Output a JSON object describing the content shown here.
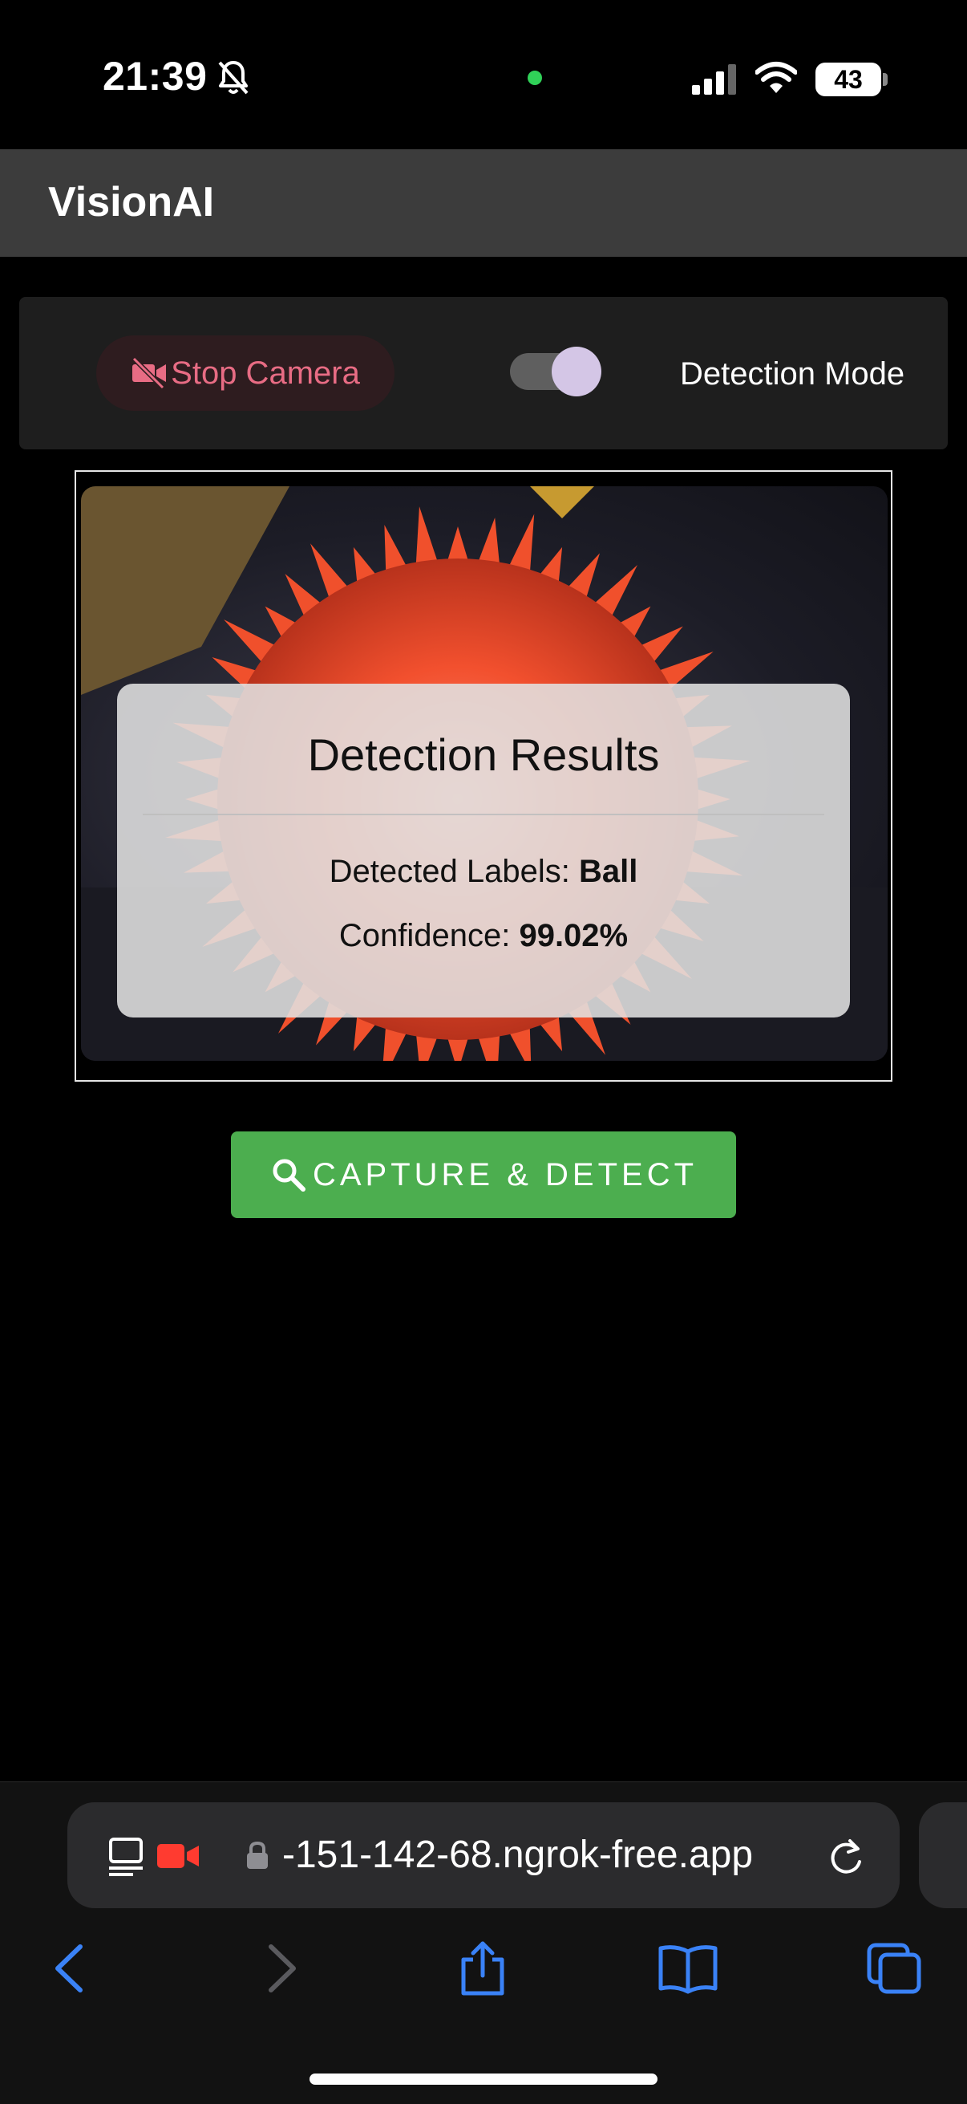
{
  "status_bar": {
    "time": "21:39",
    "battery": "43"
  },
  "app": {
    "title": "VisionAI"
  },
  "controls": {
    "stop_camera_label": "Stop Camera",
    "detection_mode_label": "Detection Mode",
    "detection_mode_on": true
  },
  "results": {
    "title": "Detection Results",
    "labels_prefix": "Detected Labels: ",
    "labels_value": "Ball",
    "confidence_prefix": "Confidence: ",
    "confidence_value": "99.02%"
  },
  "capture_button_label": "CAPTURE & DETECT",
  "browser": {
    "url": "-151-142-68.ngrok-free.app"
  },
  "colors": {
    "accent_green": "#4cae4f",
    "stop_camera_text": "#e86c84",
    "ios_blue": "#3a82f7"
  }
}
